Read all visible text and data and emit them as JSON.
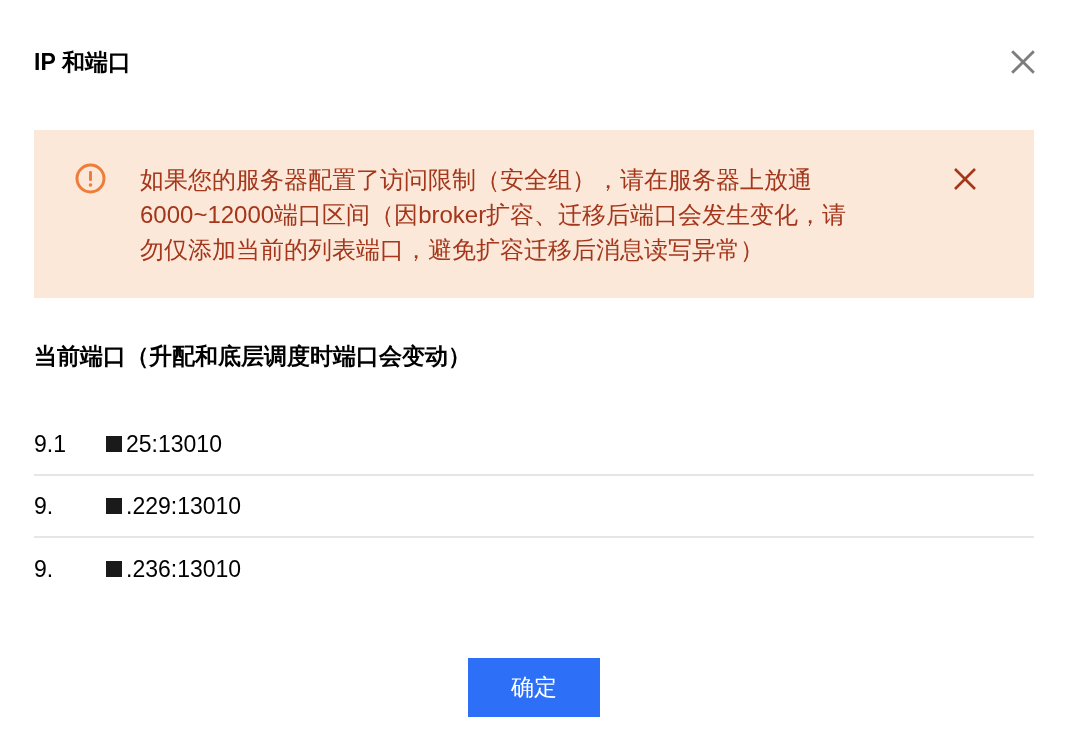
{
  "dialog": {
    "title": "IP 和端口",
    "alert": {
      "kind": "warning",
      "message": "如果您的服务器配置了访问限制（安全组），请在服务器上放通6000~12000端口区间（因broker扩容、迁移后端口会发生变化，请勿仅添加当前的列表端口，避免扩容迁移后消息读写异常）"
    },
    "section_title": "当前端口（升配和底层调度时端口会变动）",
    "endpoints": [
      {
        "visible_start": "9.1",
        "visible_end": "25:13010"
      },
      {
        "visible_start": "9.",
        "visible_end": ".229:13010"
      },
      {
        "visible_start": "9.",
        "visible_end": ".236:13010"
      }
    ],
    "buttons": [
      {
        "label": "确定",
        "kind": "primary"
      }
    ]
  }
}
